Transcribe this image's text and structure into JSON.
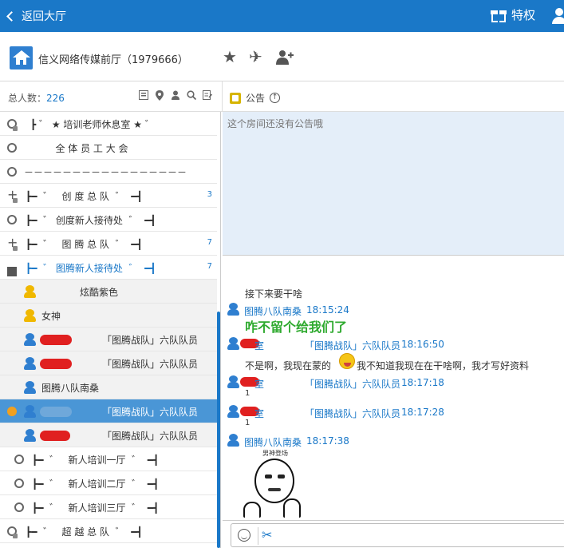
{
  "topbar": {
    "back_label": "返回大厅",
    "privilege_label": "特权"
  },
  "room": {
    "name": "信义网络传媒前厅（1979666）"
  },
  "left_header": {
    "total_label": "总人数：",
    "total_count": "226"
  },
  "notice": {
    "tab_label": "公告",
    "empty_text": "这个房间还没有公告哦"
  },
  "channels": [
    {
      "label": "┣ ゛ ★ 培训老师休息室 ★ ゛",
      "count": ""
    },
    {
      "label": "   全 体 员 工 大 会",
      "count": ""
    },
    {
      "label": "－－－－－－－－－－－－－－－－－",
      "count": ""
    },
    {
      "label": "┣━  ゛   创 度 总 队  ゛  ━┫",
      "count": "3"
    },
    {
      "label": "┣━  ゛ 创度新人接待处  ゛  ━┫",
      "count": ""
    },
    {
      "label": "┣━  ゛   图 腾 总 队  ゛  ━┫",
      "count": "7"
    },
    {
      "label": "┣━  ゛ 图腾新人接待处  ゛  ━┫",
      "count": "7"
    }
  ],
  "members": [
    {
      "name": "炫酷紫色",
      "role": ""
    },
    {
      "name": "女神",
      "role": ""
    },
    {
      "name": "",
      "role": "「图腾战队」六队队员"
    },
    {
      "name": "",
      "role": "「图腾战队」六队队员"
    },
    {
      "name": "图腾八队南桑",
      "role": ""
    },
    {
      "name": "",
      "role": "「图腾战队」六队队员"
    },
    {
      "name": "",
      "role": "「图腾战队」六队队员"
    }
  ],
  "sub_channels": [
    {
      "label": "┣━  ゛   新人培训一厅  ゛  ━┫"
    },
    {
      "label": "┣━  ゛   新人培训二厅  ゛  ━┫"
    },
    {
      "label": "┣━  ゛   新人培训三厅  ゛  ━┫"
    },
    {
      "label": "┣━  ゛   超 越 总 队  ゛  ━┫"
    }
  ],
  "chat": {
    "line0": "接下来要干啥",
    "m1_user": "图腾八队南桑",
    "m1_time": "18:15:24",
    "m1_text": "咋不留个给我们了",
    "m2_user_suffix": "室",
    "m2_role": "「图腾战队」六队队员",
    "m2_time": "18:16:50",
    "m2_text_a": "不是啊，我现在蒙的",
    "m2_text_b": "我不知道我现在在干啥啊，我才写好资料",
    "m3_user_suffix": "室",
    "m3_role": "「图腾战队」六队队员",
    "m3_time": "18:17:18",
    "m3_text": "1",
    "m4_user_suffix": "室",
    "m4_role": "「图腾战队」六队队员",
    "m4_time": "18:17:28",
    "m4_text": "1",
    "m5_user": "图腾八队南桑",
    "m5_time": "18:17:38",
    "sticker_caption": "男神登场"
  },
  "icons": {
    "gift": "gift-icon",
    "user": "user-icon",
    "home": "home-icon",
    "star": "star-icon",
    "plane": "plane-icon",
    "add_user": "add-user-icon",
    "scissors": "scissors-icon",
    "emoji": "emoji-icon"
  },
  "colors": {
    "accent": "#1a78c8",
    "selected_row": "#4a96d6",
    "notice_bg": "#e4eef9",
    "highlight_text": "#2faa2f"
  }
}
